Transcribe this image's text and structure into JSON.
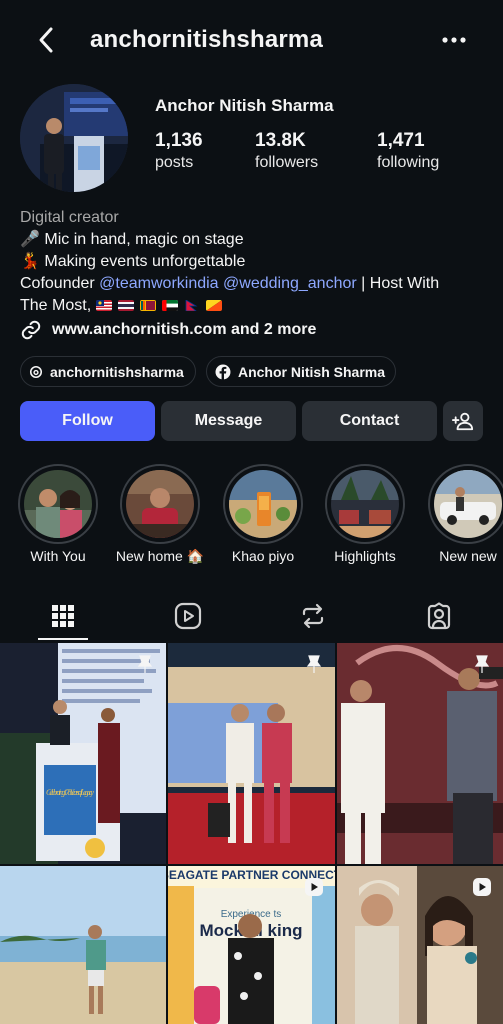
{
  "header": {
    "username": "anchornitishsharma",
    "back_icon": "chevron-left-icon",
    "more_icon": "more-horizontal-icon"
  },
  "profile": {
    "display_name": "Anchor Nitish Sharma",
    "stats": [
      {
        "value": "1,136",
        "label": "posts"
      },
      {
        "value": "13.8K",
        "label": "followers"
      },
      {
        "value": "1,471",
        "label": "following"
      }
    ],
    "category": "Digital creator",
    "bio_line1": "🎤 Mic in hand, magic on stage",
    "bio_line2": "💃 Making events unforgettable",
    "bio_cofounder": "Cofounder",
    "mention1": "@teamworkindia",
    "mention2": "@wedding_anchor",
    "bio_host": "| Host With",
    "bio_line4": "The Most,",
    "link_text": "www.anchornitish.com and 2 more"
  },
  "social_pills": [
    {
      "label": "anchornitishsharma",
      "icon": "threads-icon"
    },
    {
      "label": "Anchor Nitish Sharma",
      "icon": "facebook-icon"
    }
  ],
  "actions": {
    "follow": "Follow",
    "message": "Message",
    "contact": "Contact",
    "add_user_icon": "add-person-icon"
  },
  "highlights": [
    {
      "label": "With You"
    },
    {
      "label": "New home 🏠"
    },
    {
      "label": "Khao piyo"
    },
    {
      "label": "Highlights"
    },
    {
      "label": "New new"
    }
  ],
  "tabs": [
    {
      "name": "grid",
      "icon": "grid-icon",
      "active": true
    },
    {
      "name": "reels",
      "icon": "reels-icon",
      "active": false
    },
    {
      "name": "reposts",
      "icon": "repost-icon",
      "active": false
    },
    {
      "name": "tagged",
      "icon": "tagged-user-icon",
      "active": false
    }
  ],
  "posts": {
    "post1_sign": "Celebrating 178 Years of Legacy",
    "post5_title": "SEAGATE PARTNER CONNECT",
    "post5_sub1": "Experience    ts",
    "post5_sub2": "Mocktai     king"
  },
  "colors": {
    "background": "#0c1014",
    "accent": "#4a5df9",
    "mention": "#8ea8ff",
    "button": "#2a2f35"
  }
}
